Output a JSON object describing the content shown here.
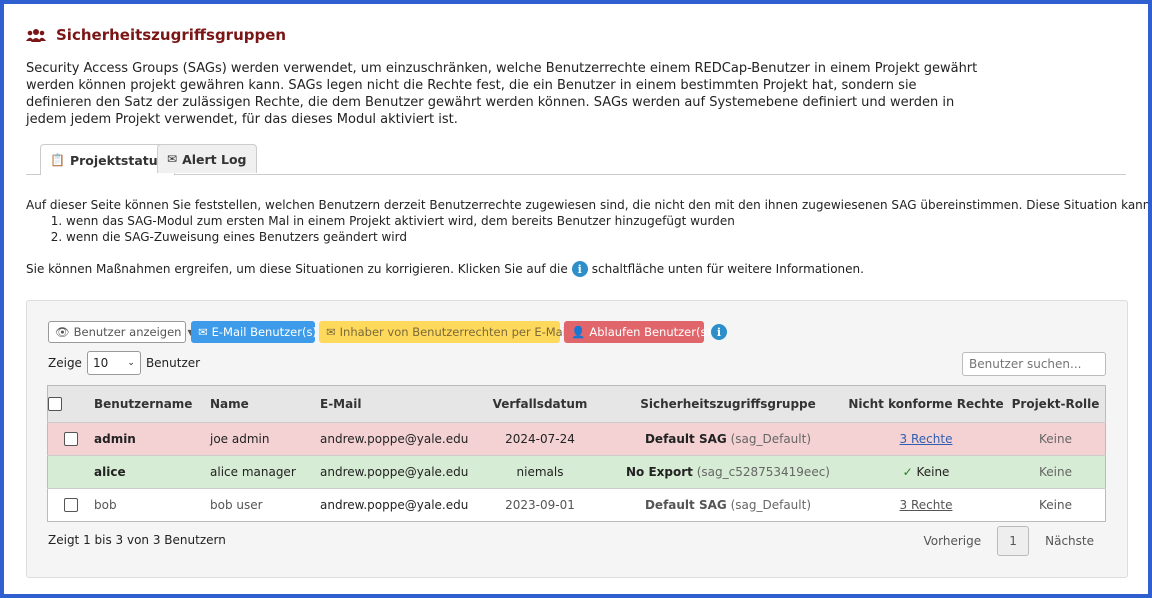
{
  "page": {
    "title": "Sicherheitszugriffsgruppen",
    "intro": "Security Access Groups (SAGs) werden verwendet, um einzuschränken, welche Benutzerrechte einem REDCap-Benutzer in einem Projekt gewährt werden können projekt gewähren kann. SAGs legen nicht die Rechte fest, die ein Benutzer in einem bestimmten Projekt hat, sondern sie definieren den Satz der zulässigen Rechte, die dem Benutzer gewährt werden können. SAGs werden auf Systemebene definiert und werden in jedem jedem Projekt verwendet, für das dieses Modul aktiviert ist."
  },
  "tabs": [
    {
      "label": "Projektstatus",
      "icon": "clipboard-check-icon",
      "active": true
    },
    {
      "label": "Alert Log",
      "icon": "envelopes-icon",
      "active": false
    }
  ],
  "description": {
    "line": "Auf dieser Seite können Sie feststellen, welchen Benutzern derzeit Benutzerrechte zugewiesen sind, die nicht den mit den ihnen zugewiesenen SAG übereinstimmen. Diese Situation kann entstehen",
    "items": [
      "wenn das SAG-Modul zum ersten Mal in einem Projekt aktiviert wird, dem bereits Benutzer hinzugefügt wurden",
      "wenn die SAG-Zuweisung eines Benutzers geändert wird"
    ],
    "action_prefix": "Sie können Maßnahmen ergreifen, um diese Situationen zu korrigieren. Klicken Sie auf die",
    "action_suffix": "schaltfläche unten für weitere Informationen."
  },
  "toolbar": {
    "show_users": "Benutzer anzeigen",
    "email_users": "E-Mail Benutzer(s)",
    "email_owners": "Inhaber von Benutzerrechten per E-Mail",
    "expire_users": "Ablaufen Benutzer(s)"
  },
  "table_controls": {
    "show_prefix": "Zeige",
    "show_value": "10",
    "show_suffix": "Benutzer",
    "search_placeholder": "Benutzer suchen..."
  },
  "table": {
    "headers": [
      "Benutzername",
      "Name",
      "E-Mail",
      "Verfallsdatum",
      "Sicherheitszugriffsgruppe",
      "Nicht konforme Rechte",
      "Projekt-Rolle"
    ],
    "rows": [
      {
        "username": "admin",
        "name": "joe admin",
        "email": "andrew.poppe@yale.edu",
        "expiration": "2024-07-24",
        "sag_name": "Default SAG",
        "sag_id": "(sag_Default)",
        "noncompliant": "3 Rechte",
        "role": "Keine"
      },
      {
        "username": "alice",
        "name": "alice manager",
        "email": "andrew.poppe@yale.edu",
        "expiration": "niemals",
        "sag_name": "No Export",
        "sag_id": "(sag_c528753419eec)",
        "noncompliant": "Keine",
        "role": "Keine"
      },
      {
        "username": "bob",
        "name": "bob user",
        "email": "andrew.poppe@yale.edu",
        "expiration": "2023-09-01",
        "sag_name": "Default SAG",
        "sag_id": "(sag_Default)",
        "noncompliant": "3 Rechte",
        "role": "Keine"
      }
    ]
  },
  "footer": {
    "info": "Zeigt 1 bis 3 von 3 Benutzern",
    "prev": "Vorherige",
    "page": "1",
    "next": "Nächste"
  },
  "colors": {
    "title": "#7a1616",
    "email_btn": "#3d9be9",
    "owner_btn": "#ffd95c",
    "expire_btn": "#e1666b",
    "row_noncompliant": "#f4d2d4",
    "row_ok": "#d6ecd4"
  }
}
